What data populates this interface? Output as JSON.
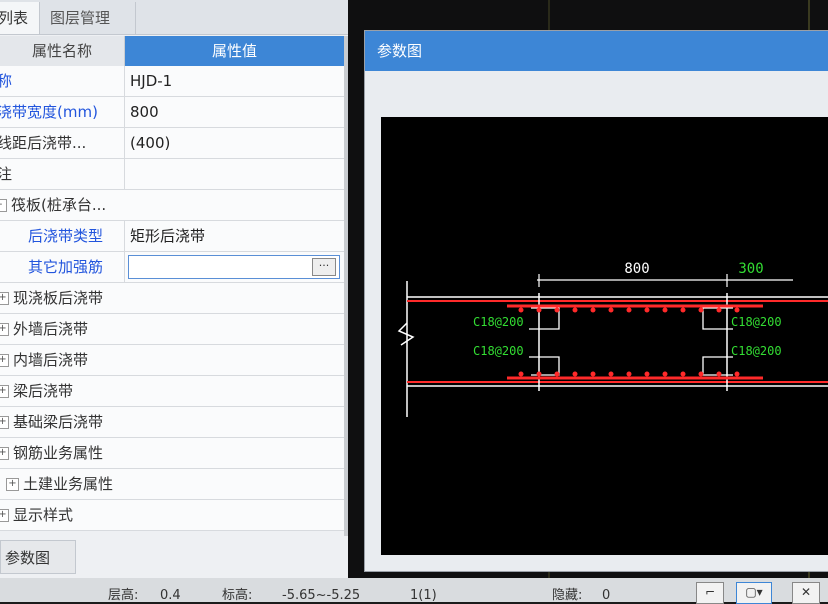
{
  "tabs": {
    "list": "列表",
    "layer": "图层管理"
  },
  "grid": {
    "header_name": "属性名称",
    "header_value": "属性值"
  },
  "rows": [
    {
      "name": "名称",
      "value": "HJD-1"
    },
    {
      "name": "后浇带宽度(mm)",
      "value": "800"
    },
    {
      "name": "轴线距后浇带...",
      "value": "(400)"
    },
    {
      "name": "备注",
      "value": ""
    },
    {
      "name": "筏板(桩承台...",
      "value": ""
    },
    {
      "name": "后浇带类型",
      "value": "矩形后浇带"
    },
    {
      "name": "其它加强筋",
      "value": ""
    },
    {
      "name": "现浇板后浇带",
      "value": ""
    },
    {
      "name": "外墙后浇带",
      "value": ""
    },
    {
      "name": "内墙后浇带",
      "value": ""
    },
    {
      "name": "梁后浇带",
      "value": ""
    },
    {
      "name": "基础梁后浇带",
      "value": ""
    },
    {
      "name": "钢筋业务属性",
      "value": ""
    },
    {
      "name": "土建业务属性",
      "value": ""
    },
    {
      "name": "显示样式",
      "value": ""
    }
  ],
  "expanders": {
    "筏板": "-",
    "plus": "+"
  },
  "dots_button": "···",
  "bottom_tab": "参数图",
  "dialog": {
    "title": "参数图",
    "dim_width": "800",
    "dim_side": "300",
    "rebar_top_left": "C18@200",
    "rebar_bottom_left": "C18@200",
    "rebar_top_right": "C18@200",
    "rebar_bottom_right": "C18@200"
  },
  "status": {
    "floor_label": "层高:",
    "floor_value": "0.4",
    "elev_label": "标高:",
    "elev_value": "-5.65~-5.25",
    "page": "1(1)",
    "hidden_label": "隐藏:",
    "hidden_value": "0"
  },
  "colors": {
    "accent": "#3d86d6",
    "link_blue": "#2255dd",
    "rebar_red": "#ff2a2a",
    "cad_green": "#33dd33"
  }
}
